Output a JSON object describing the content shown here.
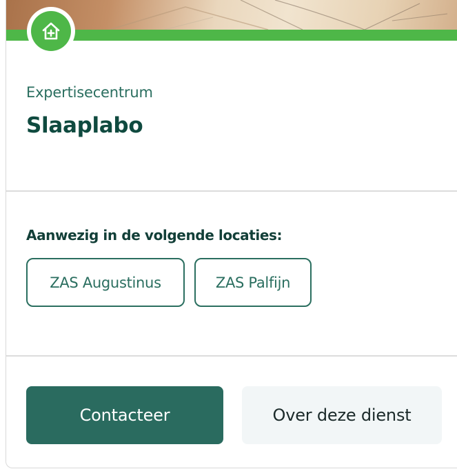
{
  "service": {
    "category": "Expertisecentrum",
    "name": "Slaaplabo",
    "icon": "home-plus-icon"
  },
  "locations": {
    "heading": "Aanwezig in de volgende locaties:",
    "items": [
      "ZAS Augustinus",
      "ZAS Palfijn"
    ]
  },
  "actions": {
    "primary_label": "Contacteer",
    "secondary_label": "Over deze dienst"
  },
  "colors": {
    "accent_green": "#4eb748",
    "dark_teal": "#2a6b5f",
    "title_green": "#0f4a3f",
    "secondary_bg": "#f2f6f7"
  }
}
